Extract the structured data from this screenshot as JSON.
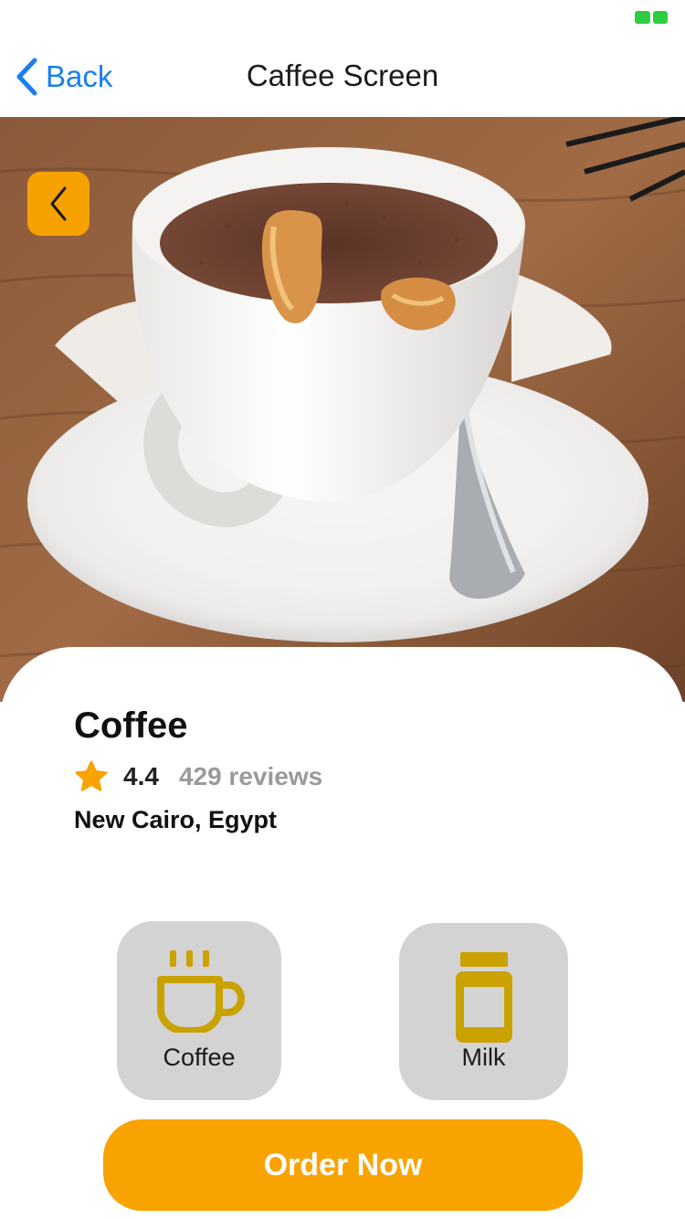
{
  "nav": {
    "back_label": "Back",
    "title": "Caffee Screen"
  },
  "hero": {
    "image_subject": "cup of coffee on saucer",
    "back_icon": "chevron-left-icon"
  },
  "product": {
    "name": "Coffee",
    "rating": "4.4",
    "reviews": "429 reviews",
    "location": "New Cairo, Egypt"
  },
  "options": [
    {
      "label": "Coffee",
      "icon": "coffee-cup-icon"
    },
    {
      "label": "Milk",
      "icon": "milk-jar-icon"
    }
  ],
  "order_button": {
    "label": "Order Now"
  },
  "colors": {
    "accent": "#f9a300",
    "icon": "#c9a200",
    "link": "#1a7ef0",
    "card": "#d3d3d3",
    "status": "#2ecc40"
  }
}
